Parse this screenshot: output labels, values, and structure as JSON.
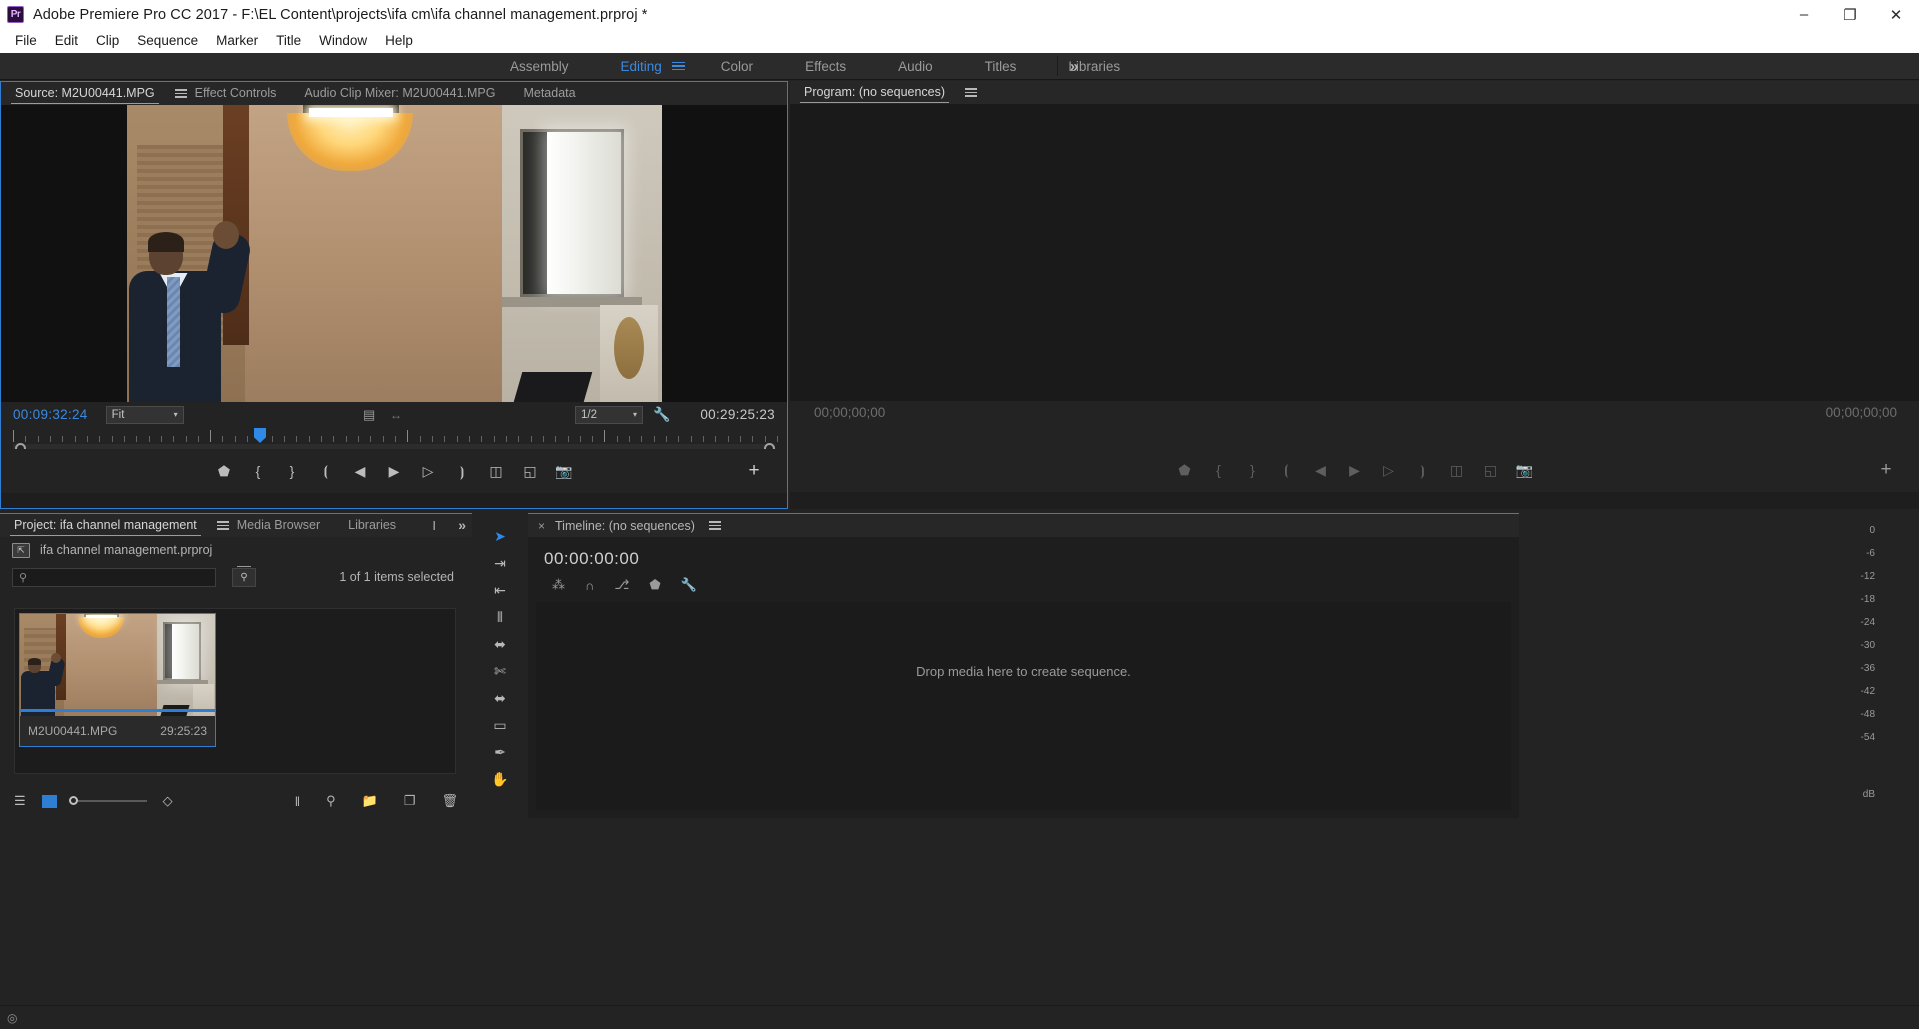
{
  "titlebar": {
    "logo": "Pr",
    "title": "Adobe Premiere Pro CC 2017 - F:\\EL Content\\projects\\ifa cm\\ifa channel management.prproj *",
    "minimize": "–",
    "maximize": "❐",
    "close": "✕"
  },
  "menubar": {
    "items": [
      {
        "label": "File"
      },
      {
        "label": "Edit"
      },
      {
        "label": "Clip"
      },
      {
        "label": "Sequence"
      },
      {
        "label": "Marker"
      },
      {
        "label": "Title"
      },
      {
        "label": "Window"
      },
      {
        "label": "Help"
      }
    ]
  },
  "workspace": {
    "tabs": [
      {
        "label": "Assembly",
        "active": false
      },
      {
        "label": "Editing",
        "active": true
      },
      {
        "label": "Color",
        "active": false
      },
      {
        "label": "Effects",
        "active": false
      },
      {
        "label": "Audio",
        "active": false
      },
      {
        "label": "Titles",
        "active": false
      },
      {
        "label": "Libraries",
        "active": false
      }
    ],
    "overflow": "»",
    "accent_color": "#3b8ae2"
  },
  "source_monitor": {
    "tabs": [
      {
        "label": "Source: M2U00441.MPG",
        "active": true
      },
      {
        "label": "Effect Controls",
        "active": false
      },
      {
        "label": "Audio Clip Mixer: M2U00441.MPG",
        "active": false
      },
      {
        "label": "Metadata",
        "active": false
      }
    ],
    "current_timecode": "00:09:32:24",
    "duration_timecode": "00:29:25:23",
    "fit_label": "Fit",
    "zoom_label": "1/2",
    "caret": "▾",
    "icons": {
      "film": "▤",
      "arrows": "↔",
      "wrench": "🔧"
    },
    "transport": [
      {
        "name": "add-marker-button",
        "glyph": "⬟"
      },
      {
        "name": "mark-in-button",
        "glyph": "{"
      },
      {
        "name": "mark-out-button",
        "glyph": "}"
      },
      {
        "name": "go-to-in-button",
        "glyph": "⦗"
      },
      {
        "name": "step-back-button",
        "glyph": "◀"
      },
      {
        "name": "play-stop-button",
        "glyph": "▶"
      },
      {
        "name": "step-forward-button",
        "glyph": "▷"
      },
      {
        "name": "go-to-out-button",
        "glyph": "⦘"
      },
      {
        "name": "insert-button",
        "glyph": "◫"
      },
      {
        "name": "overwrite-button",
        "glyph": "◱"
      },
      {
        "name": "export-frame-button",
        "glyph": "📷"
      }
    ],
    "button_editor": "+"
  },
  "program_monitor": {
    "tab_label": "Program: (no sequences)",
    "current_timecode": "00;00;00;00",
    "duration_timecode": "00;00;00;00",
    "transport": [
      {
        "name": "add-marker-button",
        "glyph": "⬟"
      },
      {
        "name": "mark-in-button",
        "glyph": "{"
      },
      {
        "name": "mark-out-button",
        "glyph": "}"
      },
      {
        "name": "go-to-in-button",
        "glyph": "⦗"
      },
      {
        "name": "step-back-button",
        "glyph": "◀"
      },
      {
        "name": "play-stop-button",
        "glyph": "▶"
      },
      {
        "name": "step-forward-button",
        "glyph": "▷"
      },
      {
        "name": "go-to-out-button",
        "glyph": "⦘"
      },
      {
        "name": "lift-button",
        "glyph": "◫"
      },
      {
        "name": "extract-button",
        "glyph": "◱"
      },
      {
        "name": "export-frame-button",
        "glyph": "📷"
      }
    ],
    "button_editor": "+"
  },
  "project_panel": {
    "tabs": [
      {
        "label": "Project: ifa channel management",
        "active": true
      },
      {
        "label": "Media Browser",
        "active": false
      },
      {
        "label": "Libraries",
        "active": false
      }
    ],
    "info_icon": "I",
    "overflow": "»",
    "breadcrumb": "ifa channel management.prproj",
    "search_placeholder": "",
    "search_icon": "⚲",
    "filter_icon": "⚲",
    "selection_status": "1 of 1 items selected",
    "items": [
      {
        "name": "M2U00441.MPG",
        "duration": "29:25:23",
        "selected": true
      }
    ],
    "footer": {
      "list_view_icon": "☰",
      "icon_view_swatch": "#2e7fd4",
      "zoom_slider_value": 0,
      "sort_icon": "◇",
      "automate_icon": "‖",
      "find_icon": "⚲",
      "new_bin_icon": "📁",
      "new_item_icon": "❐",
      "delete_icon": "🗑"
    }
  },
  "tools": [
    {
      "name": "selection-tool",
      "glyph": "➤",
      "active": true
    },
    {
      "name": "track-select-forward-tool",
      "glyph": "⇥"
    },
    {
      "name": "ripple-edit-tool",
      "glyph": "⇤"
    },
    {
      "name": "rolling-edit-tool",
      "glyph": "⦀"
    },
    {
      "name": "rate-stretch-tool",
      "glyph": "⬌"
    },
    {
      "name": "razor-tool",
      "glyph": "✄"
    },
    {
      "name": "slip-tool",
      "glyph": "⬌"
    },
    {
      "name": "slide-tool",
      "glyph": "▭"
    },
    {
      "name": "pen-tool",
      "glyph": "✒"
    },
    {
      "name": "hand-tool",
      "glyph": "✋"
    }
  ],
  "timeline_panel": {
    "close_icon": "×",
    "tab_label": "Timeline: (no sequences)",
    "timecode": "00:00:00:00",
    "toolbar": [
      {
        "name": "nest-toggle",
        "glyph": "⁂"
      },
      {
        "name": "snap-toggle",
        "glyph": "∩"
      },
      {
        "name": "linked-selection-toggle",
        "glyph": "⎇"
      },
      {
        "name": "add-marker-button",
        "glyph": "⬟"
      },
      {
        "name": "timeline-settings-button",
        "glyph": "🔧"
      }
    ],
    "drop_hint": "Drop media here to create sequence."
  },
  "audio_meters": {
    "scale": [
      "0",
      "-6",
      "-12",
      "-18",
      "-24",
      "-30",
      "-36",
      "-42",
      "-48",
      "-54"
    ],
    "unit": "dB"
  },
  "statusbar": {
    "icon": "◎"
  }
}
